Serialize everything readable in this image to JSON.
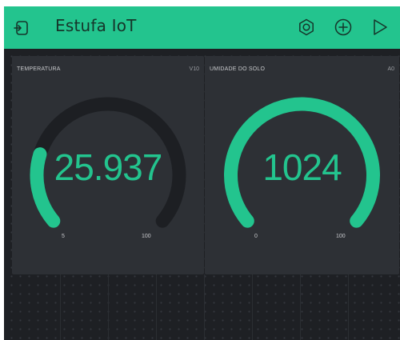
{
  "header": {
    "title": "Estufa IoT",
    "background_color": "#23c48e",
    "icons": [
      "back-icon",
      "settings-icon",
      "add-icon",
      "play-icon"
    ]
  },
  "widgets": [
    {
      "label": "TEMPERATURA",
      "pin": "V10",
      "value": "25.937",
      "min": "5",
      "max": "100",
      "level": 0.22,
      "color": "#23c48e"
    },
    {
      "label": "UMIDADE DO SOLO",
      "pin": "A0",
      "value": "1024",
      "min": "0",
      "max": "100",
      "level": 1.0,
      "color": "#23c48e"
    }
  ]
}
